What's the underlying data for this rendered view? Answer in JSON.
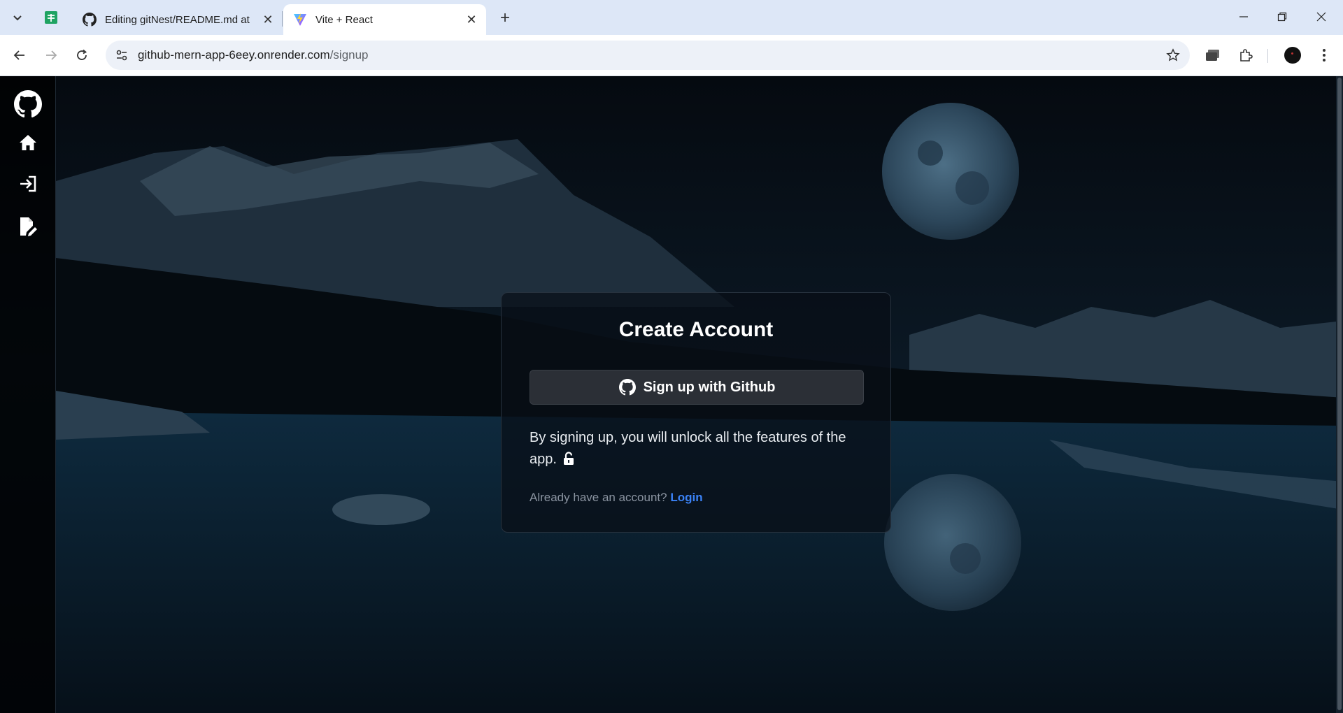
{
  "browser": {
    "tabs": [
      {
        "title": "Editing gitNest/README.md at",
        "active": false
      },
      {
        "title": "Vite + React",
        "active": true
      }
    ],
    "url_host": "github-mern-app-6eey.onrender.com",
    "url_path": "/signup"
  },
  "sidebar": {
    "items": [
      "github-logo",
      "home",
      "login",
      "signup"
    ]
  },
  "signup_card": {
    "title": "Create Account",
    "github_button_label": "Sign up with Github",
    "description": "By signing up, you will unlock all the features of the app.",
    "already_text": "Already have an account?",
    "login_label": "Login"
  },
  "colors": {
    "accent_link": "#3b82f6",
    "card_bg": "#0b131c",
    "button_bg": "#2b2f36"
  }
}
